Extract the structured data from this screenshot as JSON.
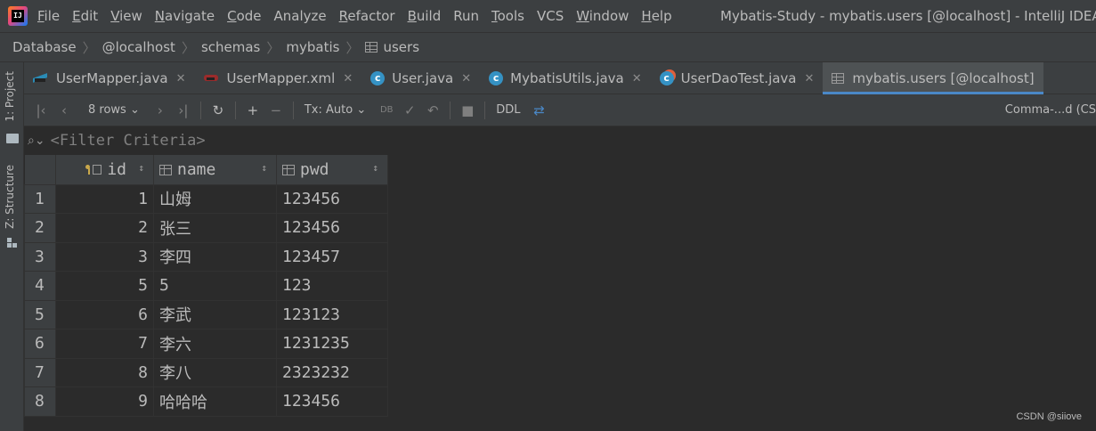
{
  "app": {
    "logo_text": "IJ"
  },
  "menu": [
    {
      "label": "File",
      "mn": "F",
      "rest": "ile"
    },
    {
      "label": "Edit",
      "mn": "E",
      "rest": "dit"
    },
    {
      "label": "View",
      "mn": "V",
      "rest": "iew"
    },
    {
      "label": "Navigate",
      "mn": "N",
      "rest": "avigate"
    },
    {
      "label": "Code",
      "mn": "C",
      "rest": "ode"
    },
    {
      "label": "Analyze",
      "mn": "",
      "rest": "Analyze"
    },
    {
      "label": "Refactor",
      "mn": "R",
      "rest": "efactor"
    },
    {
      "label": "Build",
      "mn": "B",
      "rest": "uild"
    },
    {
      "label": "Run",
      "mn": "",
      "rest": "Run"
    },
    {
      "label": "Tools",
      "mn": "T",
      "rest": "ools"
    },
    {
      "label": "VCS",
      "mn": "",
      "rest": "VCS"
    },
    {
      "label": "Window",
      "mn": "W",
      "rest": "indow"
    },
    {
      "label": "Help",
      "mn": "H",
      "rest": "elp"
    }
  ],
  "window_title": "Mybatis-Study - mybatis.users [@localhost] - IntelliJ IDEA",
  "breadcrumbs": [
    "Database",
    "@localhost",
    "schemas",
    "mybatis",
    "users"
  ],
  "side_panels": {
    "project": "1: Project",
    "structure": "Z: Structure"
  },
  "tabs": [
    {
      "label": "UserMapper.java",
      "icon": "mapper-java-icon"
    },
    {
      "label": "UserMapper.xml",
      "icon": "mapper-xml-icon"
    },
    {
      "label": "User.java",
      "icon": "class-icon",
      "glyph": "c"
    },
    {
      "label": "MybatisUtils.java",
      "icon": "class-icon",
      "glyph": "c"
    },
    {
      "label": "UserDaoTest.java",
      "icon": "test-class-icon",
      "glyph": "c"
    },
    {
      "label": "mybatis.users [@localhost]",
      "icon": "table-icon",
      "active": true
    }
  ],
  "toolbar": {
    "rows_label": "8 rows",
    "tx_label": "Tx: Auto",
    "ddl_label": "DDL",
    "console_label": "Comma-...d (CS"
  },
  "filter": {
    "placeholder": "<Filter Criteria>"
  },
  "table": {
    "columns": [
      "id",
      "name",
      "pwd"
    ],
    "rows": [
      {
        "n": "1",
        "id": "1",
        "name": "山姆",
        "pwd": "123456"
      },
      {
        "n": "2",
        "id": "2",
        "name": "张三",
        "pwd": "123456"
      },
      {
        "n": "3",
        "id": "3",
        "name": "李四",
        "pwd": "123457"
      },
      {
        "n": "4",
        "id": "5",
        "name": "5",
        "pwd": "123"
      },
      {
        "n": "5",
        "id": "6",
        "name": "李武",
        "pwd": "123123"
      },
      {
        "n": "6",
        "id": "7",
        "name": "李六",
        "pwd": "1231235"
      },
      {
        "n": "7",
        "id": "8",
        "name": "李八",
        "pwd": "2323232"
      },
      {
        "n": "8",
        "id": "9",
        "name": "哈哈哈",
        "pwd": "123456"
      }
    ]
  },
  "watermark": "CSDN @siiove",
  "colors": {
    "accent": "#4a88c7",
    "background": "#2b2b2b",
    "panel": "#3c3f41"
  }
}
